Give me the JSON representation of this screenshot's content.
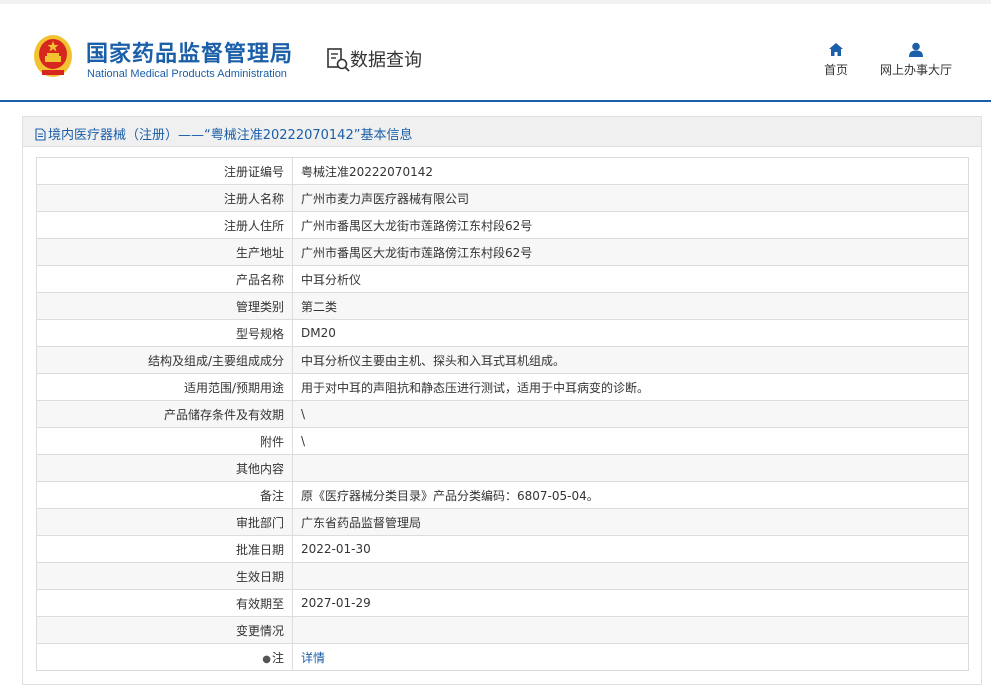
{
  "header": {
    "logo_cn": "国家药品监督管理局",
    "logo_en": "National Medical Products Administration",
    "section": "数据查询",
    "nav": [
      {
        "label": "首页",
        "icon": "home-icon"
      },
      {
        "label": "网上办事大厅",
        "icon": "user-icon"
      }
    ]
  },
  "colors": {
    "brand": "#1b5fa8",
    "emblem_red": "#d7261e",
    "emblem_gold": "#f2c230"
  },
  "panel": {
    "title": "境内医疗器械（注册）——“粤械注准20222070142”基本信息"
  },
  "rows": [
    {
      "key": "注册证编号",
      "value": "粤械注准20222070142"
    },
    {
      "key": "注册人名称",
      "value": "广州市麦力声医疗器械有限公司"
    },
    {
      "key": "注册人住所",
      "value": "广州市番禺区大龙街市莲路傍江东村段62号"
    },
    {
      "key": "生产地址",
      "value": "广州市番禺区大龙街市莲路傍江东村段62号"
    },
    {
      "key": "产品名称",
      "value": "中耳分析仪"
    },
    {
      "key": "管理类别",
      "value": "第二类"
    },
    {
      "key": "型号规格",
      "value": "DM20"
    },
    {
      "key": "结构及组成/主要组成成分",
      "value": "中耳分析仪主要由主机、探头和入耳式耳机组成。"
    },
    {
      "key": "适用范围/预期用途",
      "value": "用于对中耳的声阻抗和静态压进行测试，适用于中耳病变的诊断。"
    },
    {
      "key": "产品储存条件及有效期",
      "value": "\\"
    },
    {
      "key": "附件",
      "value": "\\"
    },
    {
      "key": "其他内容",
      "value": ""
    },
    {
      "key": "备注",
      "value": "原《医疗器械分类目录》产品分类编码：6807-05-04。"
    },
    {
      "key": "审批部门",
      "value": "广东省药品监督管理局"
    },
    {
      "key": "批准日期",
      "value": "2022-01-30"
    },
    {
      "key": "生效日期",
      "value": ""
    },
    {
      "key": "有效期至",
      "value": "2027-01-29"
    },
    {
      "key": "变更情况",
      "value": ""
    }
  ],
  "note_row": {
    "key": "注",
    "value": "详情"
  }
}
